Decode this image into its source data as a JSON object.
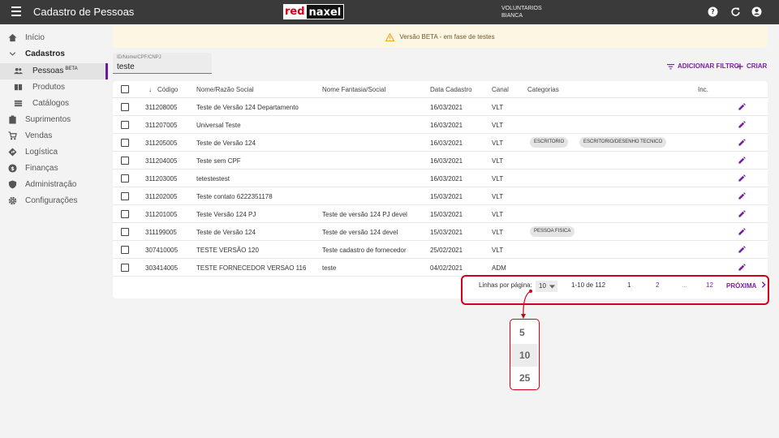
{
  "topbar": {
    "title": "Cadastro de Pessoas",
    "logo_left": "red",
    "logo_right": "naxel",
    "user_line1": "VOLUNTARIOS",
    "user_line2": "BIANCA"
  },
  "sidebar": {
    "items": [
      {
        "label": "Início"
      },
      {
        "label": "Cadastros"
      },
      {
        "label": "Pessoas",
        "badge": "BETA"
      },
      {
        "label": "Produtos"
      },
      {
        "label": "Catálogos"
      },
      {
        "label": "Suprimentos"
      },
      {
        "label": "Vendas"
      },
      {
        "label": "Logística"
      },
      {
        "label": "Finanças"
      },
      {
        "label": "Administração"
      },
      {
        "label": "Configurações"
      }
    ]
  },
  "banner": {
    "text": "Versão BETA - em fase de testes"
  },
  "search": {
    "label": "ID/Nome/CPF/CNPJ",
    "value": "teste"
  },
  "actions": {
    "add_filter": "ADICIONAR FILTRO",
    "create": "CRIAR"
  },
  "table": {
    "headers": {
      "code": "Código",
      "name": "Nome/Razão Social",
      "fantasy": "Nome Fantasia/Social",
      "date": "Data Cadastro",
      "channel": "Canal",
      "categories": "Categorias",
      "inc": "Inc."
    },
    "rows": [
      {
        "code": "311208005",
        "name": "Teste de Versão 124 Departamento",
        "fantasy": "",
        "date": "16/03/2021",
        "channel": "VLT",
        "cats": []
      },
      {
        "code": "311207005",
        "name": "Universal Teste",
        "fantasy": "",
        "date": "16/03/2021",
        "channel": "VLT",
        "cats": []
      },
      {
        "code": "311205005",
        "name": "Teste de Versão 124",
        "fantasy": "",
        "date": "16/03/2021",
        "channel": "VLT",
        "cats": [
          "ESCRITORIO",
          "ESCRITORIO/DESENHO TECNICO"
        ]
      },
      {
        "code": "311204005",
        "name": "Teste sem CPF",
        "fantasy": "",
        "date": "16/03/2021",
        "channel": "VLT",
        "cats": []
      },
      {
        "code": "311203005",
        "name": "tetestestest",
        "fantasy": "",
        "date": "16/03/2021",
        "channel": "VLT",
        "cats": []
      },
      {
        "code": "311202005",
        "name": "Teste contato 6222351178",
        "fantasy": "",
        "date": "15/03/2021",
        "channel": "VLT",
        "cats": []
      },
      {
        "code": "311201005",
        "name": "Teste Versão 124 PJ",
        "fantasy": "Teste de versão 124 PJ devel",
        "date": "15/03/2021",
        "channel": "VLT",
        "cats": []
      },
      {
        "code": "311199005",
        "name": "Teste de Versão 124",
        "fantasy": "Teste de versão 124 devel",
        "date": "15/03/2021",
        "channel": "VLT",
        "cats": [
          "PESSOA FISICA"
        ]
      },
      {
        "code": "307410005",
        "name": "TESTE VERSÃO 120",
        "fantasy": "Teste cadastro de fornecedor",
        "date": "25/02/2021",
        "channel": "VLT",
        "cats": []
      },
      {
        "code": "303414005",
        "name": "TESTE FORNECEDOR VERSAO 116",
        "fantasy": "teste",
        "date": "04/02/2021",
        "channel": "ADM",
        "cats": []
      }
    ]
  },
  "pagination": {
    "rows_label": "Linhas por página:",
    "rows_value": "10",
    "range": "1-10 de 112",
    "pages": [
      "1",
      "2",
      "...",
      "12"
    ],
    "next": "PRÓXIMA"
  },
  "dropdown": {
    "options": [
      "5",
      "10",
      "25"
    ],
    "selected": "10"
  },
  "colors": {
    "accent": "#7b1fa2",
    "highlight": "#d0021b",
    "topbar": "#3a3a3a"
  }
}
